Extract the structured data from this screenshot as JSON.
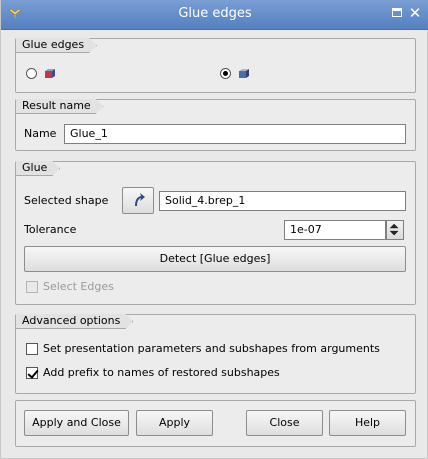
{
  "window": {
    "title": "Glue edges"
  },
  "glue_edges_group": {
    "title": "Glue edges",
    "options": [
      {
        "selected": false,
        "icon": "solid-box-red-icon"
      },
      {
        "selected": true,
        "icon": "solid-box-blue-icon"
      }
    ]
  },
  "result_group": {
    "title": "Result name",
    "name_label": "Name",
    "name_value": "Glue_1"
  },
  "glue_group": {
    "title": "Glue",
    "selected_shape_label": "Selected shape",
    "selected_shape_value": "Solid_4.brep_1",
    "tolerance_label": "Tolerance",
    "tolerance_value": "1e-07",
    "detect_button": "Detect [Glue edges]",
    "select_edges_label": "Select Edges",
    "select_edges_checked": false
  },
  "advanced_group": {
    "title": "Advanced options",
    "set_presentation_label": "Set presentation parameters and subshapes from arguments",
    "set_presentation_checked": false,
    "add_prefix_label": "Add prefix to names of restored subshapes",
    "add_prefix_checked": true
  },
  "buttons": {
    "apply_and_close": "Apply and Close",
    "apply": "Apply",
    "close": "Close",
    "help": "Help"
  }
}
